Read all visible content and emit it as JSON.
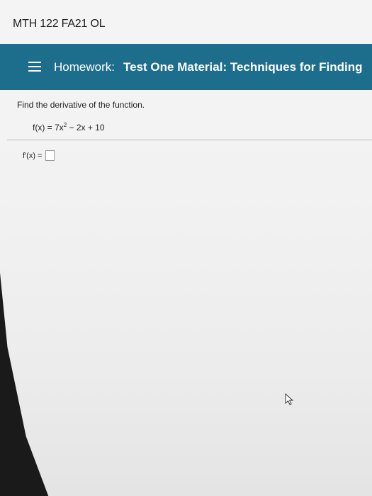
{
  "course": {
    "title": "MTH 122 FA21 OL"
  },
  "homework": {
    "label": "Homework:",
    "title": "Test One Material: Techniques for Finding"
  },
  "question": {
    "prompt": "Find the derivative of the function.",
    "function_lhs": "f(x) = 7x",
    "function_exponent": "2",
    "function_rhs": " − 2x + 10",
    "answer_label": "f'(x) ="
  },
  "colors": {
    "header_bar": "#1d6d8d"
  },
  "icons": {
    "menu": "hamburger-menu-icon",
    "cursor": "mouse-pointer-icon"
  }
}
